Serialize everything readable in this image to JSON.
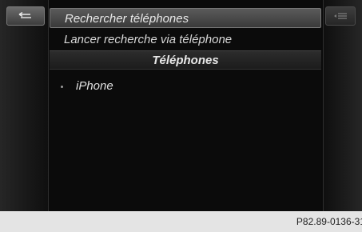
{
  "menu": {
    "title": "Rechercher téléphones",
    "action": "Lancer recherche via téléphone",
    "section_header": "Téléphones",
    "devices": [
      "iPhone"
    ]
  },
  "icons": {
    "back": "back-arrow-icon",
    "menu": "list-menu-icon"
  },
  "footer": {
    "reference": "P82.89-0136-31"
  }
}
